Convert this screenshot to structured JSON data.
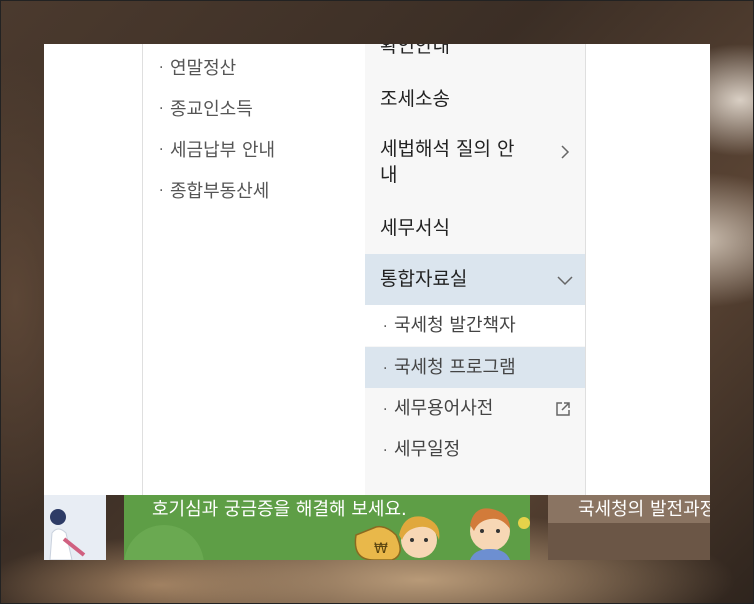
{
  "left_submenu": {
    "items": [
      "연말정산",
      "종교인소득",
      "세금납부 안내",
      "종합부동산세"
    ]
  },
  "menu": {
    "items": [
      {
        "label": "확인안내"
      },
      {
        "label": "조세소송"
      },
      {
        "label": "세법해석 질의 안내"
      },
      {
        "label": "세무서식"
      },
      {
        "label": "통합자료실"
      }
    ],
    "expanded_label": "통합자료실",
    "sub_items": [
      {
        "label": "국세청 발간책자"
      },
      {
        "label": "국세청 프로그램"
      },
      {
        "label": "세무용어사전"
      },
      {
        "label": "세무일정"
      }
    ]
  },
  "banners": {
    "center_text": "호기심과 궁금증을 해결해 보세요.",
    "right_text": "국세청의 발전과정"
  },
  "colors": {
    "active_bg": "#dbe5ee",
    "menu_bg": "#f7f7f7",
    "banner_green": "#5e9e46"
  },
  "icons": [
    "chevron-right-icon",
    "chevron-down-icon",
    "external-link-icon",
    "money-bag-icon"
  ]
}
